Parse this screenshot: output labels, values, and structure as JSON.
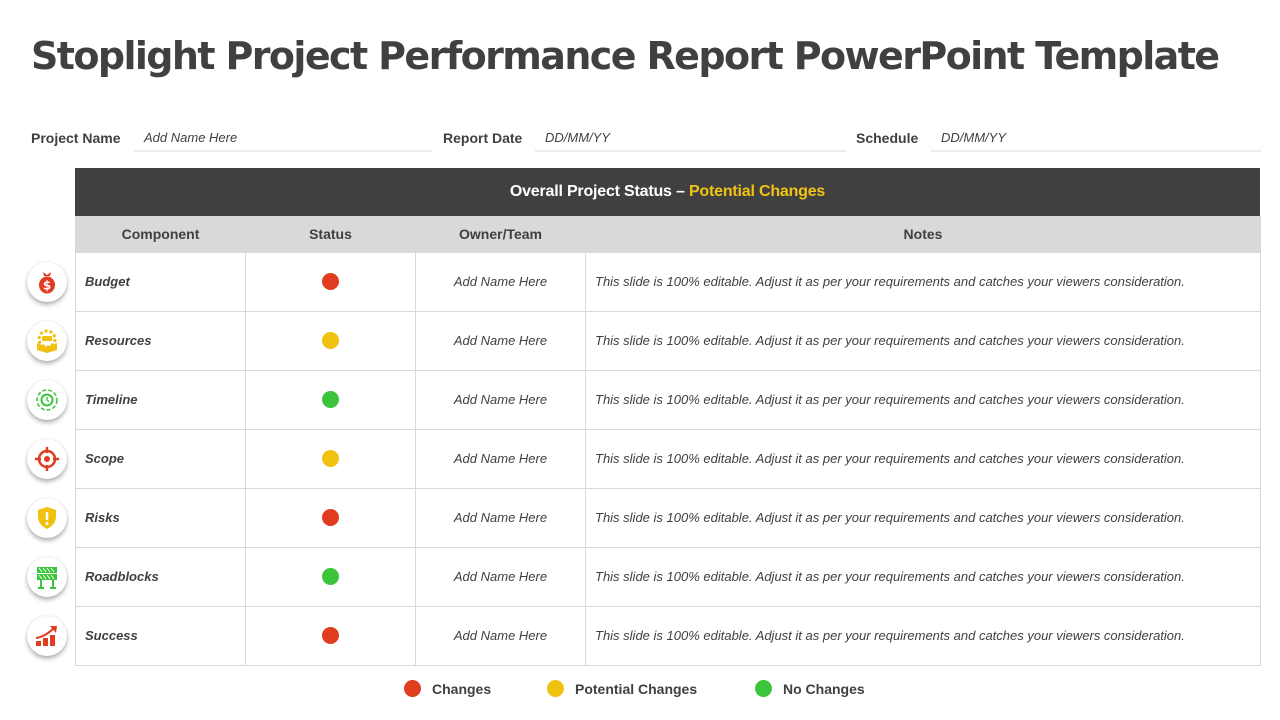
{
  "title": "Stoplight Project Performance Report PowerPoint Template",
  "fields": [
    {
      "label": "Project Name",
      "value": "Add Name Here"
    },
    {
      "label": "Report Date",
      "value": "DD/MM/YY"
    },
    {
      "label": "Schedule",
      "value": "DD/MM/YY"
    }
  ],
  "overall_status": {
    "prefix": "Overall Project Status – ",
    "value": "Potential Changes"
  },
  "columns": [
    "Component",
    "Status",
    "Owner/Team",
    "Notes"
  ],
  "colors": {
    "changes": "#e03c1f",
    "potential_changes": "#f0c20f",
    "no_changes": "#3cc43c",
    "header_dark": "#404040",
    "header_light": "#d9d9d9",
    "accent": "#f2c314"
  },
  "rows": [
    {
      "icon": "money-bag-icon",
      "component": "Budget",
      "status": "Changes",
      "owner": "Add Name Here",
      "notes": "This slide is 100% editable. Adjust it as per your requirements and catches your viewers consideration."
    },
    {
      "icon": "resources-gear-box-icon",
      "component": "Resources",
      "status": "Potential Changes",
      "owner": "Add Name Here",
      "notes": "This slide is 100% editable. Adjust it as per your requirements and catches your viewers consideration."
    },
    {
      "icon": "timeline-clock-icon",
      "component": "Timeline",
      "status": "No Changes",
      "owner": "Add Name Here",
      "notes": "This slide is 100% editable. Adjust it as per your requirements and catches your viewers consideration."
    },
    {
      "icon": "target-crosshair-icon",
      "component": "Scope",
      "status": "Potential Changes",
      "owner": "Add Name Here",
      "notes": "This slide is 100% editable. Adjust it as per your requirements and catches your viewers consideration."
    },
    {
      "icon": "shield-warning-icon",
      "component": "Risks",
      "status": "Changes",
      "owner": "Add Name Here",
      "notes": "This slide is 100% editable. Adjust it as per your requirements and catches your viewers consideration."
    },
    {
      "icon": "roadblock-barrier-icon",
      "component": "Roadblocks",
      "status": "No Changes",
      "owner": "Add Name Here",
      "notes": "This slide is 100% editable. Adjust it as per your requirements and catches your viewers consideration."
    },
    {
      "icon": "growth-chart-icon",
      "component": "Success",
      "status": "Changes",
      "owner": "Add Name Here",
      "notes": "This slide is 100% editable. Adjust it as per your requirements and catches your viewers consideration."
    }
  ],
  "legend": [
    {
      "label": "Changes",
      "color": "#e03c1f"
    },
    {
      "label": "Potential Changes",
      "color": "#f0c20f"
    },
    {
      "label": "No Changes",
      "color": "#3cc43c"
    }
  ]
}
